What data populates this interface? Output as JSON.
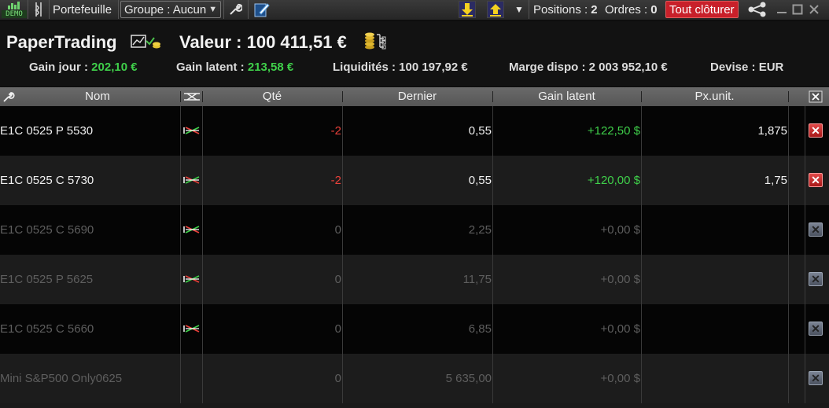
{
  "toolbar": {
    "demo_badge": "DEMO",
    "portfolio_label": "Portefeuille",
    "group_label": "Groupe : Aucun",
    "positions_label": "Positions :",
    "positions_count": "2",
    "orders_label": "Ordres :",
    "orders_count": "0",
    "close_all_label": "Tout clôturer"
  },
  "summary": {
    "account_name": "PaperTrading",
    "value_text": "Valeur : 100 411,51 €",
    "gain_day_label": "Gain jour :",
    "gain_day_value": "202,10 €",
    "gain_latent_label": "Gain latent :",
    "gain_latent_value": "213,58 €",
    "liquidity_text": "Liquidités : 100 197,92 €",
    "margin_text": "Marge dispo : 2 003 952,10 €",
    "currency_text": "Devise : EUR"
  },
  "table": {
    "columns": {
      "name": "Nom",
      "qty": "Qté",
      "last": "Dernier",
      "gain": "Gain latent",
      "unit_price": "Px.unit."
    },
    "rows": [
      {
        "name": "E1C 0525 P 5530",
        "qty": "-2",
        "last": "0,55",
        "gain": "+122,50 $",
        "unit_price": "1,875"
      },
      {
        "name": "E1C 0525 C 5730",
        "qty": "-2",
        "last": "0,55",
        "gain": "+120,00 $",
        "unit_price": "1,75"
      },
      {
        "name": "E1C 0525 C 5690",
        "qty": "0",
        "last": "2,25",
        "gain": "+0,00 $",
        "unit_price": ""
      },
      {
        "name": "E1C 0525 P 5625",
        "qty": "0",
        "last": "11,75",
        "gain": "+0,00 $",
        "unit_price": ""
      },
      {
        "name": "E1C 0525 C 5660",
        "qty": "0",
        "last": "6,85",
        "gain": "+0,00 $",
        "unit_price": ""
      },
      {
        "name": "Mini S&P500 Only0625",
        "qty": "0",
        "last": "5 635,00",
        "gain": "+0,00 $",
        "unit_price": ""
      }
    ]
  },
  "colors": {
    "positive": "#3fcf4a",
    "negative": "#e8403a",
    "close_all_bg": "#c8202a",
    "header_bg": "#5e5e5e"
  },
  "icons": [
    "demo-icon",
    "portfolio-icon",
    "wrench-icon",
    "edit-icon",
    "arrow-down-icon",
    "arrow-up-icon",
    "chevron-down-icon",
    "share-icon",
    "minimize-icon",
    "maximize-icon",
    "close-icon",
    "chart-coins-icon",
    "coins-icon",
    "strategy-icon",
    "delete-icon",
    "settings-icon"
  ]
}
